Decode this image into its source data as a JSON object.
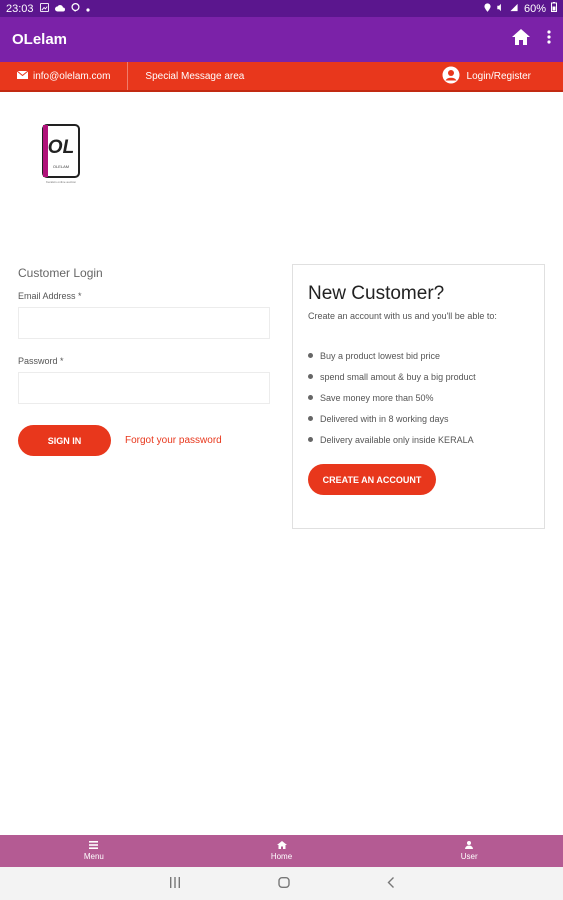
{
  "status_bar": {
    "time": "23:03",
    "battery": "60%"
  },
  "app_bar": {
    "title": "OLelam"
  },
  "strip": {
    "email": "info@olelam.com",
    "message": "Special Message area",
    "login": "Login/Register"
  },
  "logo": {
    "mark": "OL",
    "name": "OLELAM",
    "tagline": "Kerala's online auction"
  },
  "login": {
    "title": "Customer Login",
    "email_label": "Email Address *",
    "password_label": "Password *",
    "signin": "SIGN IN",
    "forgot": "Forgot your password"
  },
  "new_customer": {
    "title": "New Customer?",
    "subtitle": "Create an account with us and you'll be able to:",
    "benefits": [
      "Buy a product lowest bid price",
      "spend small amout & buy a big product",
      "Save money more than 50%",
      "Delivered with in 8 working days",
      "Delivery available only inside KERALA"
    ],
    "create": "CREATE AN ACCOUNT"
  },
  "bottom_nav": {
    "menu": "Menu",
    "home": "Home",
    "user": "User"
  },
  "colors": {
    "primary": "#7b22a8",
    "status": "#5b168e",
    "accent": "#e8371c",
    "bottom_nav": "#b45b93"
  }
}
